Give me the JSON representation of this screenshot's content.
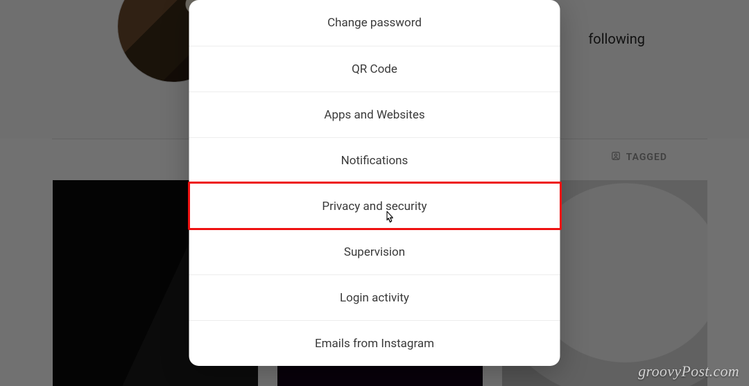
{
  "profile": {
    "following_label": "following",
    "tabs": {
      "tagged_label": "TAGGED"
    }
  },
  "modal": {
    "items": [
      {
        "key": "change-password",
        "label": "Change password"
      },
      {
        "key": "qr-code",
        "label": "QR Code"
      },
      {
        "key": "apps-and-websites",
        "label": "Apps and Websites"
      },
      {
        "key": "notifications",
        "label": "Notifications"
      },
      {
        "key": "privacy-and-security",
        "label": "Privacy and security"
      },
      {
        "key": "supervision",
        "label": "Supervision"
      },
      {
        "key": "login-activity",
        "label": "Login activity"
      },
      {
        "key": "emails-from-instagram",
        "label": "Emails from Instagram"
      }
    ],
    "highlighted_index": 4
  },
  "watermark": {
    "text": "groovyPost.com"
  },
  "colors": {
    "modal_bg": "#ffffff",
    "text": "#3a3a3a",
    "divider": "#ededed",
    "highlight": "#ee1111",
    "scrim": "rgba(0,0,0,0.55)"
  }
}
